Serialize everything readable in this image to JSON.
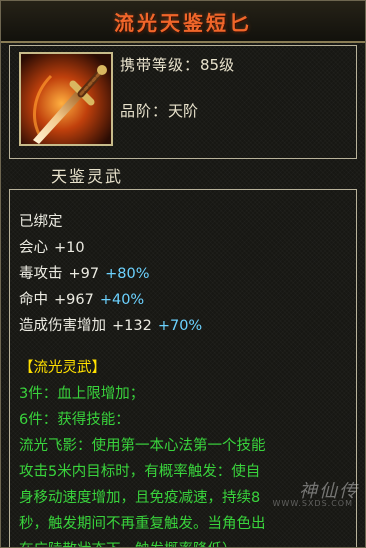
{
  "item": {
    "name": "流光天鉴短匕",
    "icon": "dagger-icon",
    "level_label": "携带等级：",
    "level_value": "85级",
    "grade_label": "品阶：",
    "grade_value": "天阶",
    "sub_name": "天鉴灵武"
  },
  "details": {
    "bound": "已绑定",
    "attributes": [
      {
        "label": "会心",
        "base": "+10",
        "bonus": ""
      },
      {
        "label": "毒攻击",
        "base": "+97",
        "bonus": "+80%"
      },
      {
        "label": "命中",
        "base": "+967",
        "bonus": "+40%"
      },
      {
        "label": "造成伤害增加",
        "base": "+132",
        "bonus": "+70%"
      }
    ],
    "set_title": "【流光灵武】",
    "set_lines": [
      "3件：血上限增加；",
      "6件：获得技能：",
      "流光飞影：使用第一本心法第一个技能",
      "攻击5米内目标时，有概率触发：使自",
      "身移动速度增加，且免疫减速，持续8",
      "秒，触发期间不再重复触发。当角色出",
      "在广陵散状态下，触发概率降低）"
    ]
  },
  "watermark": {
    "text": "神仙传",
    "url": "WWW.SXDS.COM"
  },
  "colors": {
    "title": "#f0662a",
    "bonus": "#6cd2ff",
    "set": "#39d33c",
    "set_title": "#ffe000"
  }
}
